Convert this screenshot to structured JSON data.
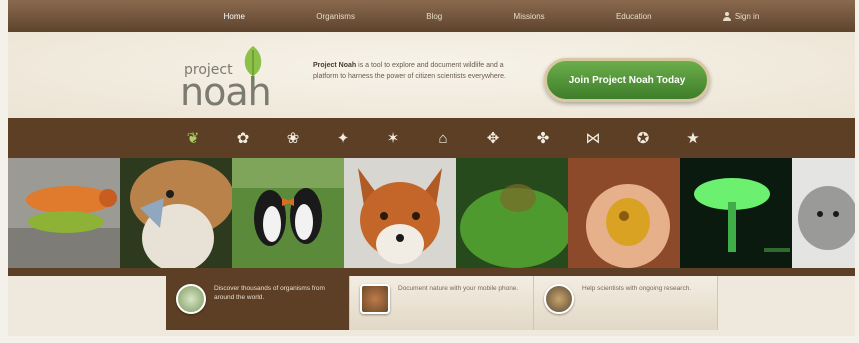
{
  "nav": {
    "items": [
      {
        "label": "Home",
        "active": true
      },
      {
        "label": "Organisms",
        "active": false
      },
      {
        "label": "Blog",
        "active": false
      },
      {
        "label": "Missions",
        "active": false
      },
      {
        "label": "Education",
        "active": false
      },
      {
        "label": "Sign in",
        "active": false,
        "icon": "user-icon"
      }
    ]
  },
  "header": {
    "logo_word1": "project",
    "logo_word2": "noah",
    "tagline_brand": "Project Noah",
    "tagline_rest": " is a tool to explore and document wildlife and a platform to harness the power of citizen scientists everywhere.",
    "join_button": "Join Project Noah Today"
  },
  "categories": [
    {
      "icon": "leaf-icon",
      "glyph": "❦",
      "active": true
    },
    {
      "icon": "flower-icon",
      "glyph": "✿"
    },
    {
      "icon": "frog-icon",
      "glyph": "❀"
    },
    {
      "icon": "bird-icon",
      "glyph": "✦"
    },
    {
      "icon": "insect-icon",
      "glyph": "✶"
    },
    {
      "icon": "mushroom-icon",
      "glyph": "⌂"
    },
    {
      "icon": "butterfly-icon",
      "glyph": "✥"
    },
    {
      "icon": "reptile-icon",
      "glyph": "✤"
    },
    {
      "icon": "fish-icon",
      "glyph": "⋈"
    },
    {
      "icon": "mammal-icon",
      "glyph": "✪"
    },
    {
      "icon": "starfish-icon",
      "glyph": "★"
    }
  ],
  "photos": [
    "caterpillar",
    "eagle",
    "puffins",
    "fox",
    "frog-leaf",
    "spider",
    "glowing-mushroom",
    "arctic-fox"
  ],
  "features": [
    {
      "text": "Discover thousands of organisms from around the world.",
      "icon": "globe-icon",
      "active": true
    },
    {
      "text": "Document nature with your mobile phone.",
      "icon": "camera-bird-icon",
      "active": false
    },
    {
      "text": "Help scientists with ongoing research.",
      "icon": "research-icon",
      "active": false
    }
  ],
  "colors": {
    "brown": "#5d3f26",
    "green_button": "#4f9638",
    "cream": "#efe9dd"
  }
}
